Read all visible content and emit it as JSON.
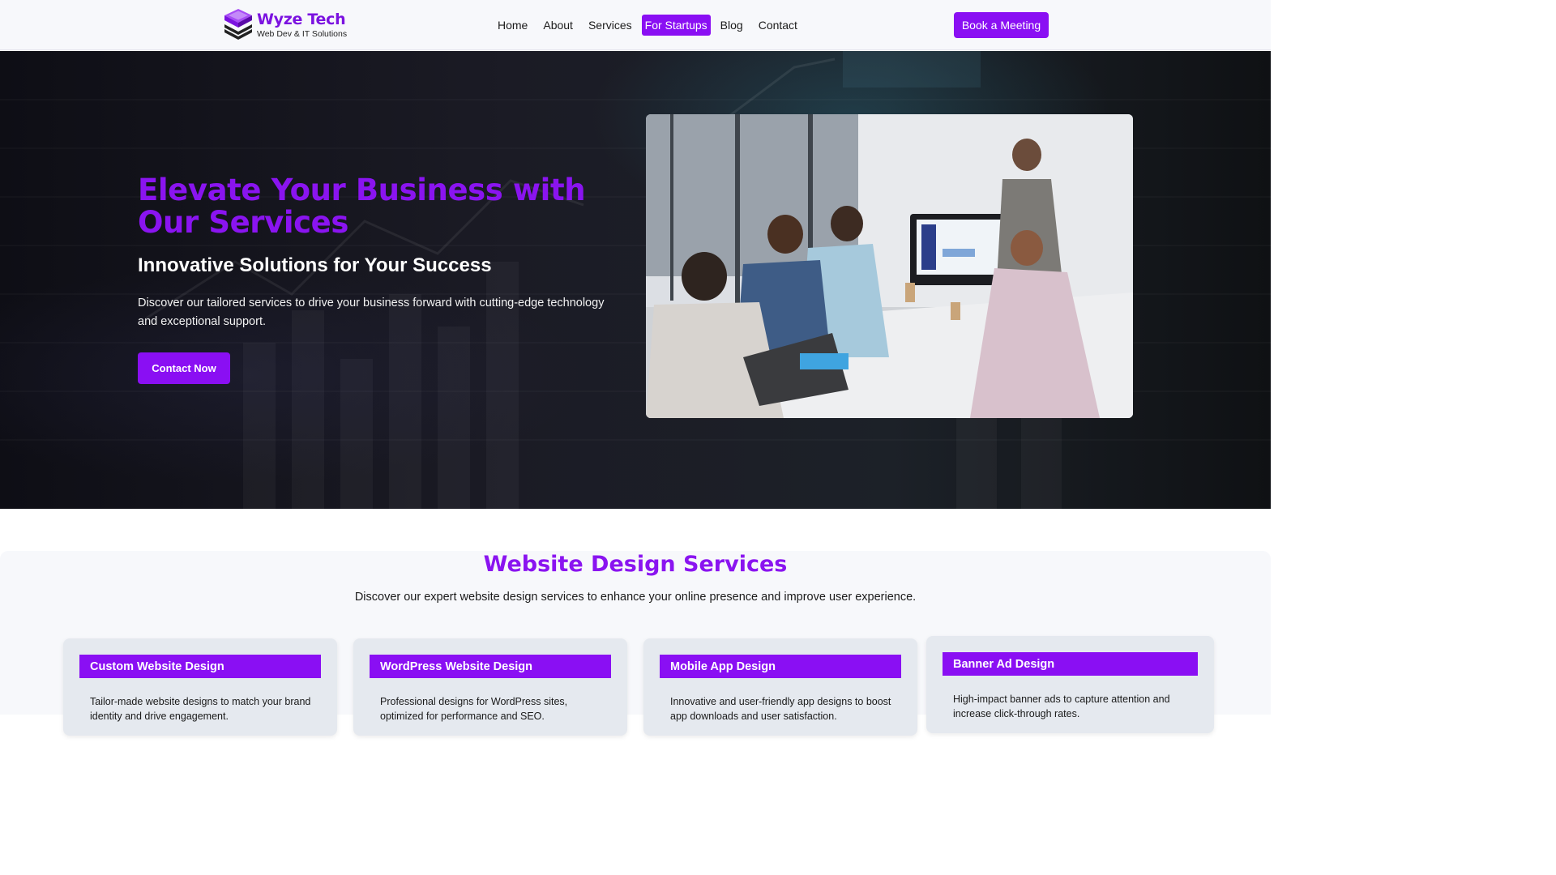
{
  "header": {
    "logo_name": "Wyze Tech",
    "logo_tagline": "Web Dev & IT Solutions",
    "nav": [
      "Home",
      "About",
      "Services",
      "For Startups",
      "Blog",
      "Contact"
    ],
    "active_nav": "For Startups",
    "cta": "Book a Meeting"
  },
  "hero": {
    "title": "Elevate Your Business with Our Services",
    "subtitle": "Innovative Solutions for Your Success",
    "description": "Discover our tailored services to drive your business forward with cutting-edge technology and exceptional support.",
    "button": "Contact Now"
  },
  "services": {
    "title": "Website Design Services",
    "description": "Discover our expert website design services to enhance your online presence and improve user experience.",
    "cards": [
      {
        "title": "Custom Website Design",
        "text": "Tailor-made website designs to match your brand identity and drive engagement."
      },
      {
        "title": "WordPress Website Design",
        "text": "Professional designs for WordPress sites, optimized for performance and SEO."
      },
      {
        "title": "Mobile App Design",
        "text": "Innovative and user-friendly app designs to boost app downloads and user satisfaction."
      },
      {
        "title": "Banner Ad Design",
        "text": "High-impact banner ads to capture attention and increase click-through rates."
      }
    ]
  },
  "colors": {
    "accent": "#8a0ff3",
    "heading_purple": "#8a14f0",
    "hero_bg": "#15161d",
    "page_bg": "#f7f8fb",
    "card_bg": "#e5e9ef"
  },
  "icons": [
    "stacked-books-logo-icon"
  ]
}
